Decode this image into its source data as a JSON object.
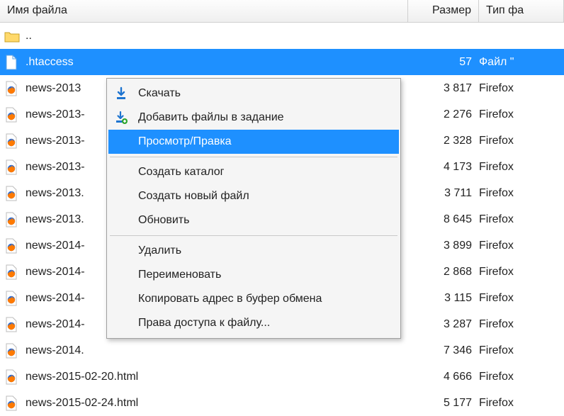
{
  "columns": {
    "name": "Имя файла",
    "size": "Размер",
    "type": "Тип фа"
  },
  "parent_row": {
    "label": ".."
  },
  "selected_file": {
    "name": ".htaccess",
    "size": "57",
    "type": "Файл \""
  },
  "files": [
    {
      "name": "news-2013",
      "size": "3 817",
      "type": "Firefox"
    },
    {
      "name": "news-2013-",
      "size": "2 276",
      "type": "Firefox"
    },
    {
      "name": "news-2013-",
      "size": "2 328",
      "type": "Firefox"
    },
    {
      "name": "news-2013-",
      "size": "4 173",
      "type": "Firefox"
    },
    {
      "name": "news-2013.",
      "size": "3 711",
      "type": "Firefox"
    },
    {
      "name": "news-2013.",
      "size": "8 645",
      "type": "Firefox"
    },
    {
      "name": "news-2014-",
      "size": "3 899",
      "type": "Firefox"
    },
    {
      "name": "news-2014-",
      "size": "2 868",
      "type": "Firefox"
    },
    {
      "name": "news-2014-",
      "size": "3 115",
      "type": "Firefox"
    },
    {
      "name": "news-2014-",
      "size": "3 287",
      "type": "Firefox"
    },
    {
      "name": "news-2014.",
      "size": "7 346",
      "type": "Firefox"
    },
    {
      "name": "news-2015-02-20.html",
      "size": "4 666",
      "type": "Firefox"
    },
    {
      "name": "news-2015-02-24.html",
      "size": "5 177",
      "type": "Firefox"
    }
  ],
  "context_menu": {
    "download": "Скачать",
    "add_to_task": "Добавить файлы в задание",
    "view_edit": "Просмотр/Правка",
    "create_dir": "Создать каталог",
    "create_file": "Создать новый файл",
    "refresh": "Обновить",
    "delete": "Удалить",
    "rename": "Переименовать",
    "copy_addr": "Копировать адрес в буфер обмена",
    "permissions": "Права доступа к файлу..."
  }
}
